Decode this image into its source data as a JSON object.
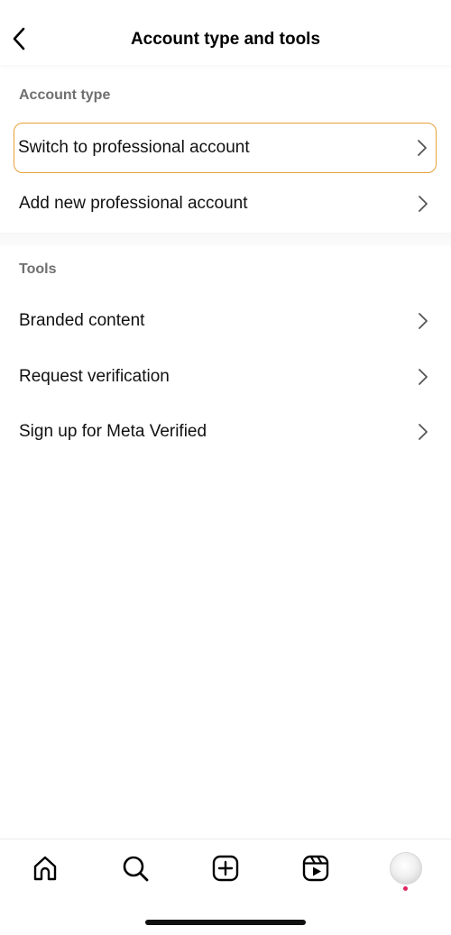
{
  "header": {
    "title": "Account type and tools",
    "back_icon": "chevron-left-icon"
  },
  "account_type_section": {
    "label": "Account type",
    "items": [
      {
        "label": "Switch to professional account",
        "highlighted": true
      },
      {
        "label": "Add new professional account",
        "highlighted": false
      }
    ]
  },
  "tools_section": {
    "label": "Tools",
    "items": [
      {
        "label": "Branded content"
      },
      {
        "label": "Request verification"
      },
      {
        "label": "Sign up for Meta Verified"
      }
    ]
  },
  "bottom_nav": {
    "items": [
      "home-icon",
      "search-icon",
      "create-plus-icon",
      "reels-icon",
      "profile-avatar"
    ]
  },
  "colors": {
    "highlight_border": "#e8a03a",
    "section_label": "#6f6f6f",
    "notification_dot": "#e0245e"
  }
}
